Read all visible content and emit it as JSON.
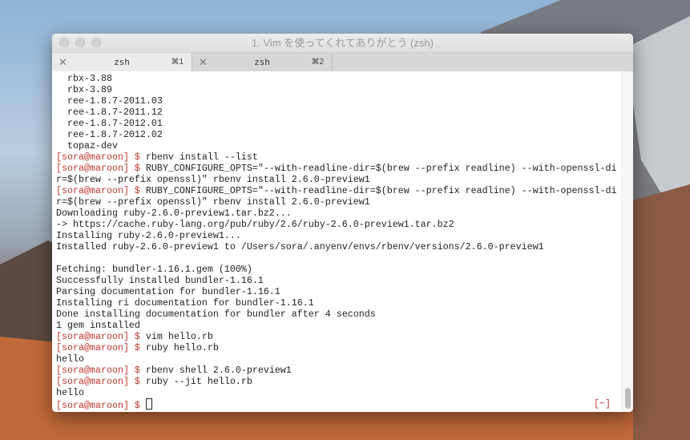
{
  "window": {
    "title": "1. Vim を使ってくれてありがとう (zsh)"
  },
  "tabs": [
    {
      "label": "zsh",
      "shortcut": "⌘1"
    },
    {
      "label": "zsh",
      "shortcut": "⌘2"
    }
  ],
  "prompt": "[sora@maroon] $",
  "lines": [
    {
      "t": "  rbx-3.88"
    },
    {
      "t": "  rbx-3.89"
    },
    {
      "t": "  ree-1.8.7-2011.03"
    },
    {
      "t": "  ree-1.8.7-2011.12"
    },
    {
      "t": "  ree-1.8.7-2012.01"
    },
    {
      "t": "  ree-1.8.7-2012.02"
    },
    {
      "t": "  topaz-dev"
    },
    {
      "p": true,
      "t": " rbenv install --list"
    },
    {
      "p": true,
      "t": " RUBY_CONFIGURE_OPTS=\"--with-readline-dir=$(brew --prefix readline) --with-openssl-di"
    },
    {
      "t": "r=$(brew --prefix openssl)\" rbenv install 2.6.0-preview1"
    },
    {
      "p": true,
      "t": " RUBY_CONFIGURE_OPTS=\"--with-readline-dir=$(brew --prefix readline) --with-openssl-di"
    },
    {
      "t": "r=$(brew --prefix openssl)\" rbenv install 2.6.0-preview1"
    },
    {
      "t": "Downloading ruby-2.6.0-preview1.tar.bz2..."
    },
    {
      "t": "-> https://cache.ruby-lang.org/pub/ruby/2.6/ruby-2.6.0-preview1.tar.bz2"
    },
    {
      "t": "Installing ruby-2.6.0-preview1..."
    },
    {
      "t": "Installed ruby-2.6.0-preview1 to /Users/sora/.anyenv/envs/rbenv/versions/2.6.0-preview1"
    },
    {
      "t": ""
    },
    {
      "t": "Fetching: bundler-1.16.1.gem (100%)"
    },
    {
      "t": "Successfully installed bundler-1.16.1"
    },
    {
      "t": "Parsing documentation for bundler-1.16.1"
    },
    {
      "t": "Installing ri documentation for bundler-1.16.1"
    },
    {
      "t": "Done installing documentation for bundler after 4 seconds"
    },
    {
      "t": "1 gem installed"
    },
    {
      "p": true,
      "t": " vim hello.rb"
    },
    {
      "p": true,
      "t": " ruby hello.rb"
    },
    {
      "t": "hello"
    },
    {
      "p": true,
      "t": " rbenv shell 2.6.0-preview1"
    },
    {
      "p": true,
      "t": " ruby --jit hello.rb"
    },
    {
      "t": "hello"
    }
  ],
  "right_prompt": "[~]"
}
